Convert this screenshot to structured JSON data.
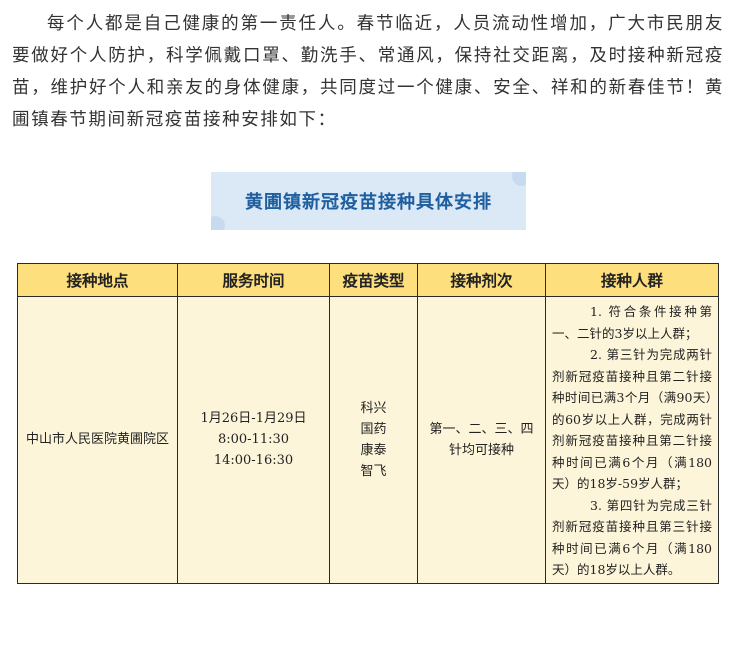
{
  "intro": "每个人都是自己健康的第一责任人。春节临近，人员流动性增加，广大市民朋友要做好个人防护，科学佩戴口罩、勤洗手、常通风，保持社交距离，及时接种新冠疫苗，维护好个人和亲友的身体健康，共同度过一个健康、安全、祥和的新春佳节！黄圃镇春节期间新冠疫苗接种安排如下：",
  "banner_title": "黄圃镇新冠疫苗接种具体安排",
  "table": {
    "headers": [
      "接种地点",
      "服务时间",
      "疫苗类型",
      "接种剂次",
      "接种人群"
    ],
    "row": {
      "location": "中山市人民医院黄圃院区",
      "date": "1月26日-1月29日",
      "time1": "8:00-11:30",
      "time2": "14:00-16:30",
      "vaccines": [
        "科兴",
        "国药",
        "康泰",
        "智飞"
      ],
      "doses": "第一、二、三、四针均可接种",
      "groups": [
        "1. 符合条件接种第一、二针的3岁以上人群；",
        "2. 第三针为完成两针剂新冠疫苗接种且第二针接种时间已满3个月（满90天）的60岁以上人群，完成两针剂新冠疫苗接种且第二针接种时间已满6个月（满180天）的18岁-59岁人群；",
        "3. 第四针为完成三针剂新冠疫苗接种且第三针接种时间已满6个月（满180天）的18岁以上人群。"
      ]
    }
  }
}
